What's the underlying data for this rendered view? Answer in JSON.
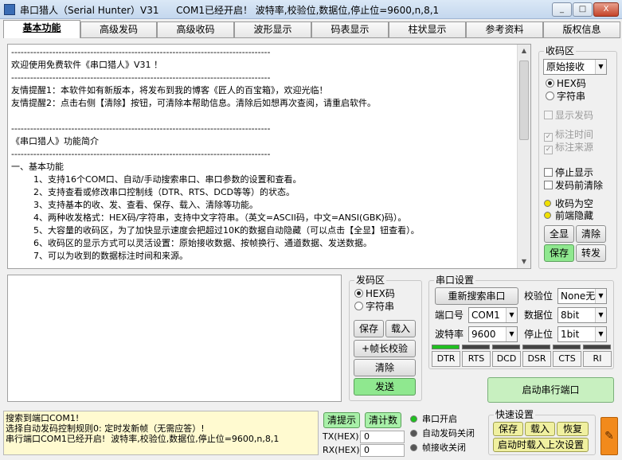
{
  "window": {
    "title": "串口猎人（Serial Hunter）V31",
    "status_title": "COM1已经开启！ 波特率,校验位,数据位,停止位=9600,n,8,1",
    "minimize": "_",
    "maximize": "□",
    "close": "X"
  },
  "tabs": [
    "基本功能",
    "高级发码",
    "高级收码",
    "波形显示",
    "码表显示",
    "柱状显示",
    "参考资料",
    "版权信息"
  ],
  "recv_text": "----------------------------------------------------------------------------------\n欢迎使用免费软件《串口猎人》V31 ！\n----------------------------------------------------------------------------------\n友情提醒1：本软件如有新版本，将发布到我的博客《匠人的百宝箱》，欢迎光临！\n友情提醒2：点击右侧【清除】按钮，可清除本帮助信息。清除后如想再次查阅，请重启软件。\n\n----------------------------------------------------------------------------------\n《串口猎人》功能简介\n----------------------------------------------------------------------------------\n一、基本功能\n        1、支持16个COM口、自动/手动搜索串口、串口参数的设置和查看。\n        2、支持查看或修改串口控制线（DTR、RTS、DCD等等）的状态。\n        3、支持基本的收、发、查看、保存、载入、清除等功能。\n        4、两种收发格式：HEX码/字符串，支持中文字符串。（英文=ASCII码，中文=ANSI(GBK)码）。\n        5、大容量的收码区，为了加快显示速度会把超过10K的数据自动隐藏（可以点击【全显】钮查看）。\n        6、收码区的显示方式可以灵活设置：原始接收数据、按帧换行、通道数据、发送数据。\n        7、可以为收到的数据标注时间和来源。",
  "recv_panel": {
    "title": "收码区",
    "mode_select": "原始接收",
    "radio_hex": "HEX码",
    "radio_str": "字符串",
    "show_send": "显示发码",
    "mark_time": "标注时间",
    "mark_source": "标注来源",
    "stop_display": "停止显示",
    "clear_before_send": "发码前清除",
    "recv_empty": "收码为空",
    "front_hidden": "前端隐藏",
    "show_all": "全显",
    "clear": "清除",
    "save": "保存",
    "transfer": "转发"
  },
  "send_panel": {
    "title": "发码区",
    "radio_hex": "HEX码",
    "radio_str": "字符串",
    "save": "保存",
    "load": "载入",
    "frame_check": "+帧长校验",
    "clear": "清除",
    "send": "发送"
  },
  "serial": {
    "title": "串口设置",
    "research": "重新搜索串口",
    "parity_label": "校验位",
    "parity_value": "None无",
    "port_label": "端口号",
    "port_value": "COM1",
    "databits_label": "数据位",
    "databits_value": "8bit",
    "baud_label": "波特率",
    "baud_value": "9600",
    "stopbits_label": "停止位",
    "stopbits_value": "1bit",
    "signals": [
      "DTR",
      "RTS",
      "DCD",
      "DSR",
      "CTS",
      "RI"
    ],
    "start_port": "启动串行端口"
  },
  "status_text": "搜索到端口COM1!\n选择自动发码控制规则0: 定时发新帧（无需应答）!\n串行端口COM1已经开启!  波特率,校验位,数据位,停止位=9600,n,8,1",
  "bottom": {
    "clear_hint": "清提示",
    "clear_count": "清计数",
    "tx_label": "TX(HEX):",
    "tx_value": "0",
    "rx_label": "RX(HEX):",
    "rx_value": "0",
    "port_open": "串口开启",
    "auto_send_off": "自动发码关闭",
    "frame_recv_off": "帧接收关闭",
    "quick_title": "快速设置",
    "quick_save": "保存",
    "quick_load": "载入",
    "quick_restore": "恢复",
    "load_last": "启动时载入上次设置"
  }
}
